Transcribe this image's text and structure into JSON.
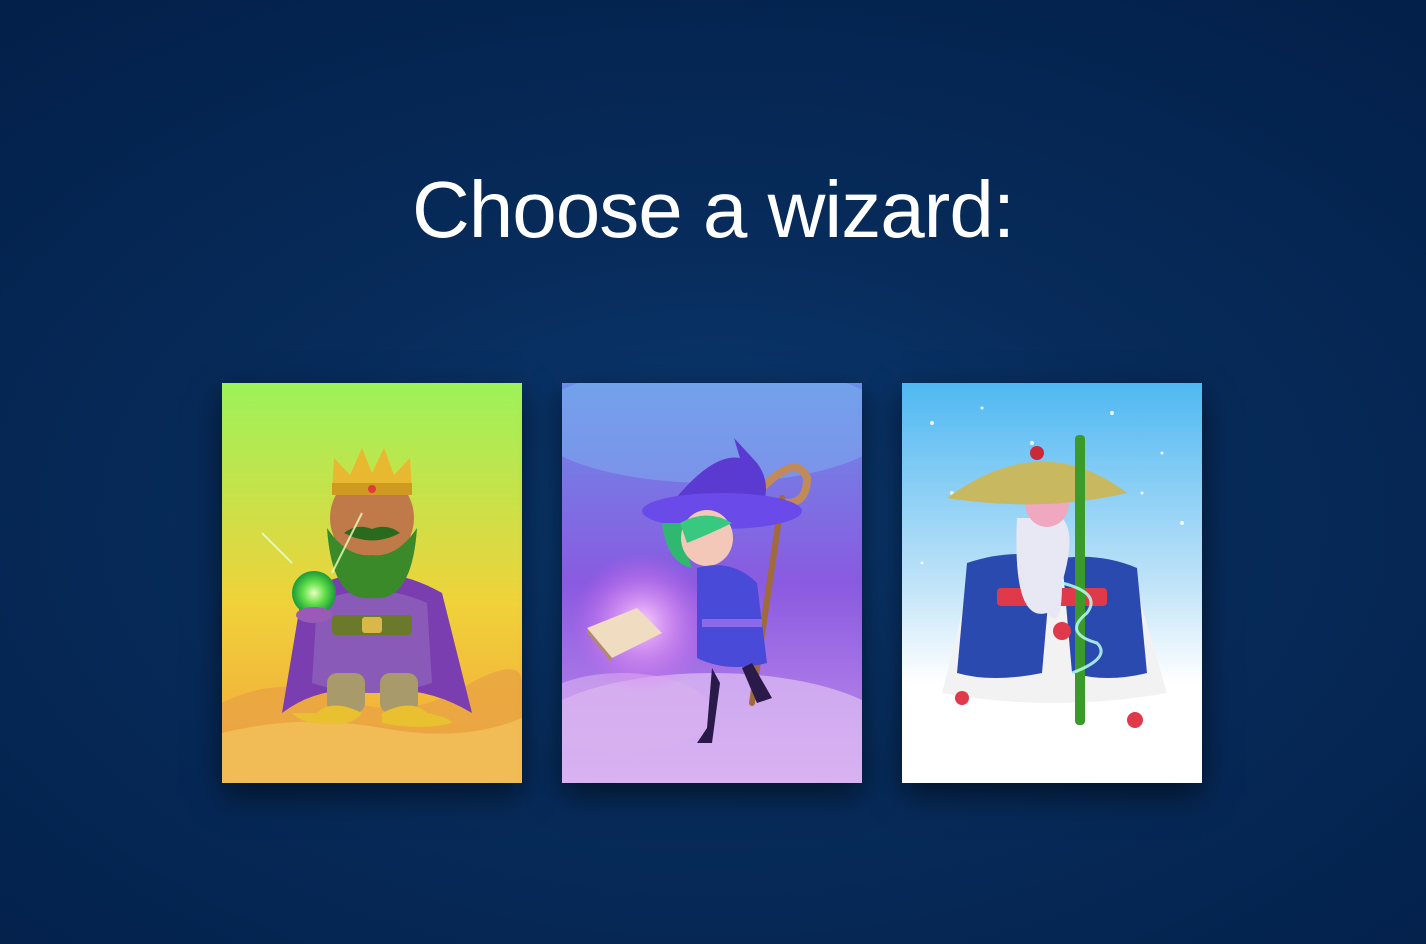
{
  "heading": "Choose a wizard:",
  "wizards": [
    {
      "id": "desert-king",
      "icon": "crowned-bearded-wizard-with-green-orb",
      "background_colors": [
        "#9df25a",
        "#f0d23a",
        "#f4a23a"
      ]
    },
    {
      "id": "cloud-witch",
      "icon": "green-haired-witch-with-spellbook-and-staff",
      "background_colors": [
        "#7fb8f0",
        "#8a5ae0",
        "#c880e8"
      ]
    },
    {
      "id": "snow-sage",
      "icon": "old-sage-with-straw-hat-and-bamboo-staff",
      "background_colors": [
        "#4fb8f2",
        "#bfe3f8",
        "#ffffff"
      ]
    }
  ]
}
